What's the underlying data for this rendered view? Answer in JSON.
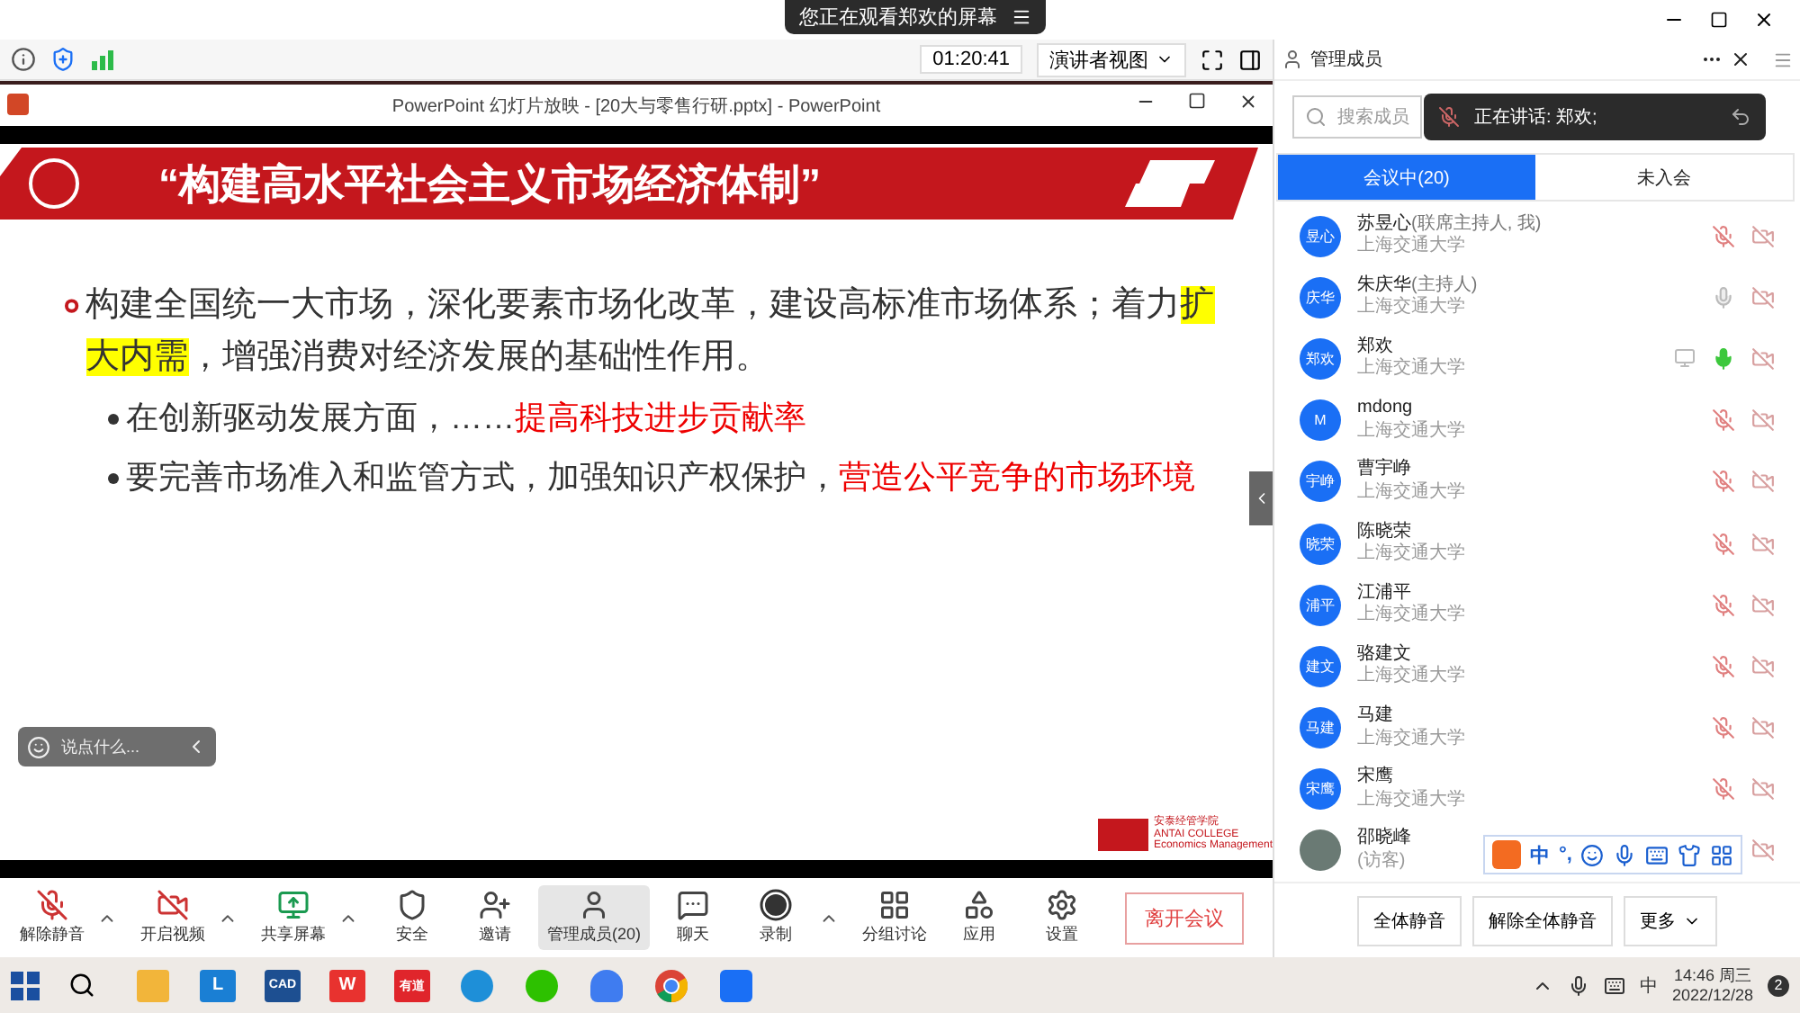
{
  "notice": {
    "text": "您正在观看郑欢的屏幕"
  },
  "meeting_bar": {
    "timer": "01:20:41",
    "view_button": "演讲者视图"
  },
  "ppt_window": {
    "title": "PowerPoint 幻灯片放映 - [20大与零售行研.pptx] - PowerPoint"
  },
  "slide": {
    "title": "“构建高水平社会主义市场经济体制”",
    "bullets": [
      {
        "segments": [
          {
            "text": "构建全国统一大市场，深化要素市场化改革，建设高标准市场体系；着力",
            "kind": "plain"
          },
          {
            "text": "扩大内需",
            "kind": "highlight"
          },
          {
            "text": "，增强消费对经济发展的基础性作用。",
            "kind": "plain"
          }
        ],
        "children": [
          {
            "segments": [
              {
                "text": "在创新驱动发展方面，……",
                "kind": "plain"
              },
              {
                "text": "提高科技进步贡献率",
                "kind": "red"
              }
            ]
          },
          {
            "segments": [
              {
                "text": "要完善市场准入和监管方式，加强知识产权保护，",
                "kind": "plain"
              },
              {
                "text": "营造公平竞争的市场环境",
                "kind": "red"
              }
            ]
          }
        ]
      }
    ],
    "logo_text": [
      "安泰经管学院",
      "ANTAI COLLEGE",
      "Economics Management"
    ]
  },
  "chat_input": {
    "placeholder": "说点什么..."
  },
  "toolbar": [
    {
      "label": "解除静音",
      "kind": "mic",
      "caret": true,
      "selected": false
    },
    {
      "label": "开启视频",
      "kind": "video",
      "caret": true,
      "selected": false
    },
    {
      "label": "共享屏幕",
      "kind": "share",
      "caret": true,
      "selected": false
    },
    {
      "label": "安全",
      "kind": "shield",
      "caret": false,
      "selected": false
    },
    {
      "label": "邀请",
      "kind": "invite",
      "caret": false,
      "selected": false
    },
    {
      "label": "管理成员(20)",
      "kind": "members",
      "caret": false,
      "selected": true
    },
    {
      "label": "聊天",
      "kind": "chat",
      "caret": false,
      "selected": false
    },
    {
      "label": "录制",
      "kind": "record",
      "caret": true,
      "selected": false
    },
    {
      "label": "分组讨论",
      "kind": "groups",
      "caret": false,
      "selected": false
    },
    {
      "label": "应用",
      "kind": "apps",
      "caret": false,
      "selected": false
    },
    {
      "label": "设置",
      "kind": "settings",
      "caret": false,
      "selected": false
    }
  ],
  "leave_button": "离开会议",
  "panel": {
    "title": "管理成员",
    "search_placeholder": "搜索成员",
    "speaking": "正在讲话: 郑欢;",
    "tabs": [
      {
        "label": "会议中(20)",
        "selected": true
      },
      {
        "label": "未入会",
        "selected": false
      }
    ],
    "participants": [
      {
        "avatar": "昱心",
        "name": "苏昱心",
        "role": "(联席主持人, 我)",
        "org": "上海交通大学",
        "muted": true,
        "sharing": false
      },
      {
        "avatar": "庆华",
        "name": "朱庆华",
        "role": "(主持人)",
        "org": "上海交通大学",
        "muted": false,
        "speaking": false,
        "sharing": false
      },
      {
        "avatar": "郑欢",
        "name": "郑欢",
        "org": "上海交通大学",
        "muted": false,
        "speaking": true,
        "sharing": true
      },
      {
        "avatar": "M",
        "name": "mdong",
        "org": "上海交通大学",
        "muted": true,
        "sharing": false
      },
      {
        "avatar": "宇峥",
        "name": "曹宇峥",
        "org": "上海交通大学",
        "muted": true,
        "sharing": false
      },
      {
        "avatar": "晓荣",
        "name": "陈晓荣",
        "org": "上海交通大学",
        "muted": true,
        "sharing": false
      },
      {
        "avatar": "浦平",
        "name": "江浦平",
        "org": "上海交通大学",
        "muted": true,
        "sharing": false
      },
      {
        "avatar": "建文",
        "name": "骆建文",
        "org": "上海交通大学",
        "muted": true,
        "sharing": false
      },
      {
        "avatar": "马建",
        "name": "马建",
        "org": "上海交通大学",
        "muted": true,
        "sharing": false
      },
      {
        "avatar": "宋鹰",
        "name": "宋鹰",
        "org": "上海交通大学",
        "muted": true,
        "sharing": false
      },
      {
        "avatar_photo": true,
        "name": "邵晓峰",
        "org": "(访客)",
        "sharing": false
      }
    ],
    "buttons": [
      "全体静音",
      "解除全体静音",
      "更多"
    ]
  },
  "ime_bar": {
    "items": [
      "中",
      "°,"
    ]
  },
  "taskbar": {
    "apps": [
      {
        "kind": "folder"
      },
      {
        "kind": "tile",
        "label": "L",
        "color": "#1a7fd4"
      },
      {
        "kind": "tile",
        "label": "CAD",
        "color": "#1d4f91"
      },
      {
        "kind": "tile",
        "label": "W",
        "color": "#e8322f"
      },
      {
        "kind": "tile",
        "label": "有道",
        "color": "#e0252b"
      },
      {
        "kind": "edge"
      },
      {
        "kind": "wechat"
      },
      {
        "kind": "cloud"
      },
      {
        "kind": "chrome"
      },
      {
        "kind": "meeting"
      }
    ],
    "ime": "中",
    "time": "14:46 周三",
    "date": "2022/12/28",
    "notifications": "2"
  }
}
